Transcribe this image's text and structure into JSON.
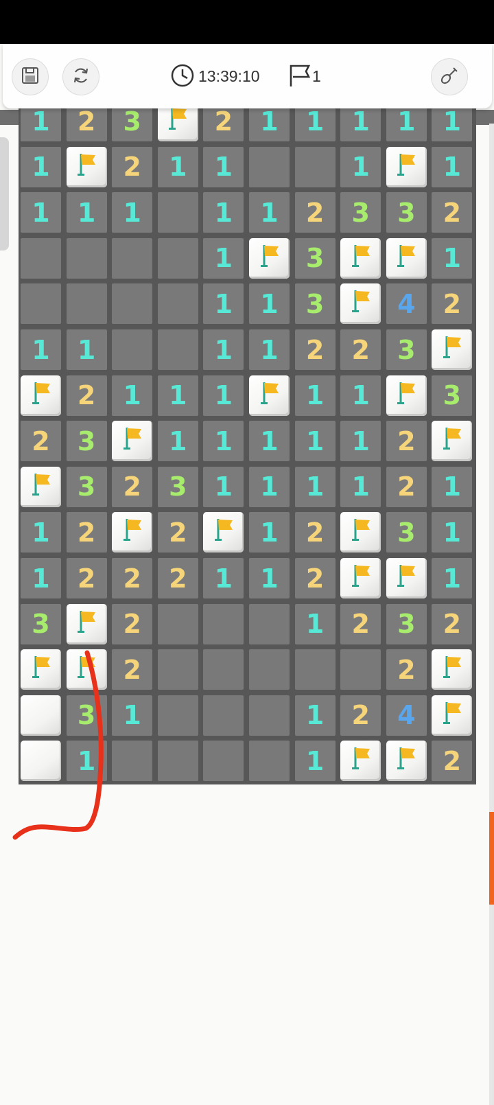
{
  "header": {
    "timer": "13:39:10",
    "flag_count": "1",
    "buttons": [
      "save-icon",
      "restart-icon",
      "shovel-icon"
    ],
    "icons": [
      "clock-icon",
      "flag-outline-icon"
    ]
  },
  "board": {
    "columns": 10,
    "rows": [
      [
        "1",
        "2",
        "3",
        "F",
        "2",
        "1",
        "1",
        "1",
        "1",
        "1"
      ],
      [
        "1",
        "F",
        "2",
        "1",
        "1",
        "",
        "",
        "1",
        "F",
        "1"
      ],
      [
        "1",
        "1",
        "1",
        "",
        "1",
        "1",
        "2",
        "3",
        "3",
        "2"
      ],
      [
        "",
        "",
        "",
        "",
        "1",
        "F",
        "3",
        "F",
        "F",
        "1"
      ],
      [
        "",
        "",
        "",
        "",
        "1",
        "1",
        "3",
        "F",
        "4",
        "2"
      ],
      [
        "1",
        "1",
        "",
        "",
        "1",
        "1",
        "2",
        "2",
        "3",
        "F"
      ],
      [
        "F",
        "2",
        "1",
        "1",
        "1",
        "F",
        "1",
        "1",
        "F",
        "3"
      ],
      [
        "2",
        "3",
        "F",
        "1",
        "1",
        "1",
        "1",
        "1",
        "2",
        "F"
      ],
      [
        "F",
        "3",
        "2",
        "3",
        "1",
        "1",
        "1",
        "1",
        "2",
        "1"
      ],
      [
        "1",
        "2",
        "F",
        "2",
        "F",
        "1",
        "2",
        "F",
        "3",
        "1"
      ],
      [
        "1",
        "2",
        "2",
        "2",
        "1",
        "1",
        "2",
        "F",
        "F",
        "1"
      ],
      [
        "3",
        "F",
        "2",
        "",
        "",
        "",
        "1",
        "2",
        "3",
        "2"
      ],
      [
        "F",
        "F",
        "2",
        "",
        "",
        "",
        "",
        "",
        "2",
        "F"
      ],
      [
        "C",
        "3",
        "1",
        "",
        "",
        "",
        "1",
        "2",
        "4",
        "F"
      ],
      [
        "C",
        "1",
        "",
        "",
        "",
        "",
        "1",
        "F",
        "F",
        "2"
      ]
    ],
    "legend": {
      "F": "flagged cell",
      "C": "covered cell",
      "": "revealed empty cell"
    }
  },
  "colors": {
    "n1": "#57e8d6",
    "n2": "#f5d47a",
    "n3": "#a8ec6e",
    "n4": "#5aa6ec",
    "flag": "#f5b820",
    "board_bg": "#575757",
    "accent_scroll": "#f0641e",
    "annotation_stroke": "#e8311a"
  }
}
